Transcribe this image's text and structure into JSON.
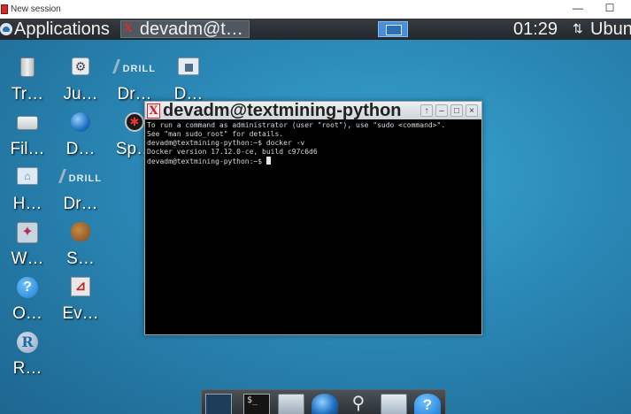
{
  "host": {
    "title": "New session",
    "minimize": "—",
    "maximize": "☐"
  },
  "panel": {
    "applications_label": "Applications",
    "task_title": "devadm@t…",
    "task_icon": "X",
    "clock": "01:29",
    "network_icon": "⇅",
    "user": "Ubuntu"
  },
  "desktop_icons": {
    "trash": "Tr…",
    "jupyter": "Ju…",
    "drill1": "Dr…",
    "doc": "D…",
    "filesystem": "Fil…",
    "d2": "D…",
    "spider": "Sp…",
    "home": "H…",
    "drill2": "Dr…",
    "w": "W…",
    "squirrel": "S…",
    "help": "O…",
    "evince": "Ev…",
    "r": "R…",
    "drill_brand": "DRILL"
  },
  "terminal": {
    "title": "devadm@textmining-python",
    "icon": "X",
    "btn_up": "↑",
    "btn_min": "–",
    "btn_max": "□",
    "btn_close": "×",
    "lines": [
      "To run a command as administrator (user \"root\"), use \"sudo <command>\".",
      "See \"man sudo_root\" for details.",
      "",
      "devadm@textmining-python:~$ docker -v",
      "Docker version 17.12.0-ce, build c97c6d6",
      "devadm@textmining-python:~$ "
    ]
  },
  "dock": {
    "terminal_label": "$_",
    "search_glyph": "⚲",
    "help_glyph": "?"
  }
}
